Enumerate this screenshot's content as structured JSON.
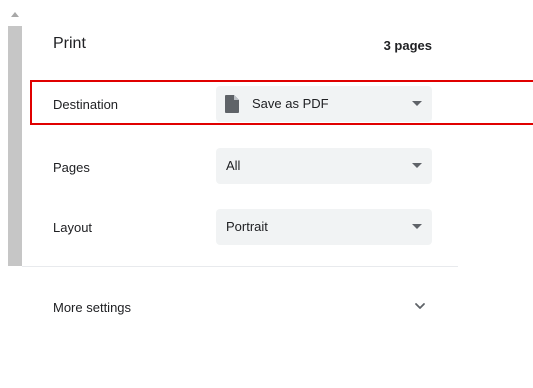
{
  "header": {
    "title": "Print",
    "page_count": "3 pages"
  },
  "settings": {
    "destination": {
      "label": "Destination",
      "value": "Save as PDF",
      "icon": "document-icon"
    },
    "pages": {
      "label": "Pages",
      "value": "All"
    },
    "layout": {
      "label": "Layout",
      "value": "Portrait"
    }
  },
  "more_settings": {
    "label": "More settings",
    "icon": "chevron-down-icon"
  },
  "colors": {
    "highlight": "#e00000",
    "select_bg": "#f1f3f4",
    "text": "#202124",
    "caret": "#5f6368"
  }
}
